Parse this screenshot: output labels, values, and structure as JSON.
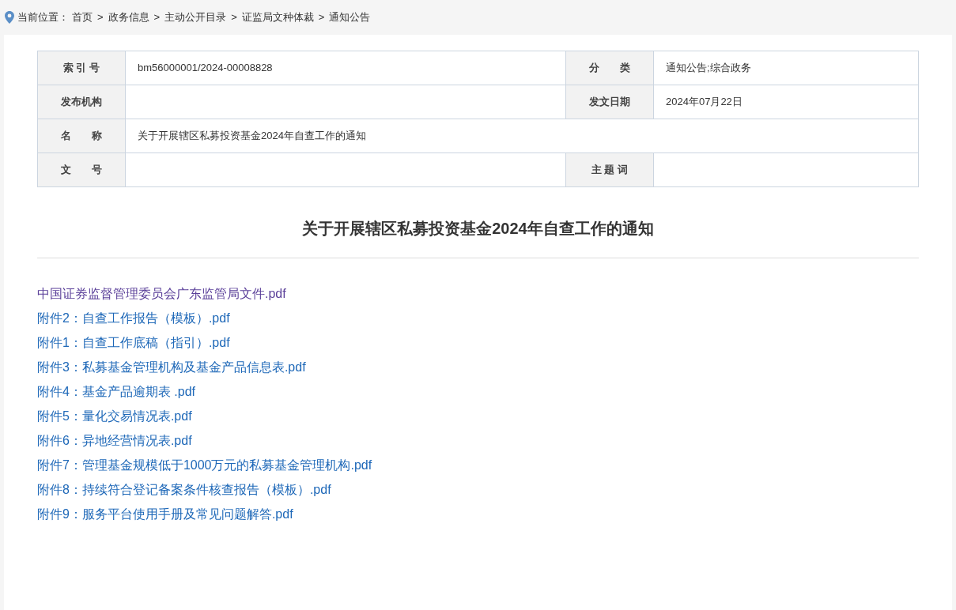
{
  "breadcrumb": {
    "label": "当前位置：",
    "items": [
      {
        "kind": "link",
        "text": "首页"
      },
      {
        "kind": "sep",
        "text": ">"
      },
      {
        "kind": "link",
        "text": "政务信息"
      },
      {
        "kind": "sep",
        "text": ">"
      },
      {
        "kind": "link",
        "text": "主动公开目录"
      },
      {
        "kind": "sep",
        "text": ">"
      },
      {
        "kind": "link",
        "text": "证监局文种体裁"
      },
      {
        "kind": "sep",
        "text": ">"
      },
      {
        "kind": "link",
        "text": "通知公告"
      }
    ]
  },
  "info_table": {
    "rows": [
      [
        {
          "label": "索 引 号",
          "value": "bm56000001/2024-00008828"
        },
        {
          "label": "分　　类",
          "value": "通知公告;综合政务"
        }
      ],
      [
        {
          "label": "发布机构"
        },
        {
          "label": "发文日期",
          "value": "2024年07月22日"
        }
      ],
      [
        {
          "label": "名　　称",
          "value": "关于开展辖区私募投资基金2024年自查工作的通知"
        }
      ],
      [
        {
          "label": "文　　号"
        },
        {
          "label": "主 题 词"
        }
      ]
    ]
  },
  "title": "关于开展辖区私募投资基金2024年自查工作的通知",
  "attachments": [
    {
      "text": "中国证券监督管理委员会广东监管局文件.pdf",
      "visited": true
    },
    {
      "text": "附件2：自查工作报告（模板）.pdf",
      "visited": false
    },
    {
      "text": "附件1：自查工作底稿（指引）.pdf",
      "visited": false
    },
    {
      "text": "附件3：私募基金管理机构及基金产品信息表.pdf",
      "visited": false
    },
    {
      "text": "附件4：基金产品逾期表 .pdf",
      "visited": false
    },
    {
      "text": "附件5：量化交易情况表.pdf",
      "visited": false
    },
    {
      "text": "附件6：异地经营情况表.pdf",
      "visited": false
    },
    {
      "text": "附件7：管理基金规模低于1000万元的私募基金管理机构.pdf",
      "visited": false
    },
    {
      "text": "附件8：持续符合登记备案条件核查报告（模板）.pdf",
      "visited": false
    },
    {
      "text": "附件9：服务平台使用手册及常见问题解答.pdf",
      "visited": false
    }
  ]
}
